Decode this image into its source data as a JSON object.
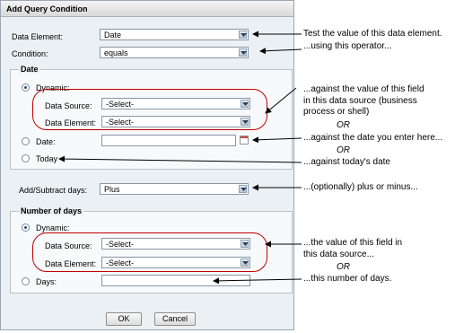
{
  "dialog": {
    "title": "Add Query Condition",
    "data_element_label": "Data Element:",
    "data_element_value": "Date",
    "condition_label": "Condition:",
    "condition_value": "equals",
    "date_group": {
      "legend": "Date",
      "dynamic_label": "Dynamic:",
      "data_source_label": "Data Source:",
      "data_source_value": "-Select-",
      "data_element_label": "Data Element:",
      "data_element_value": "-Select-",
      "date_label": "Date:",
      "date_value": "",
      "today_label": "Today"
    },
    "add_subtract_label": "Add/Subtract days:",
    "add_subtract_value": "Plus",
    "days_group": {
      "legend": "Number of days",
      "dynamic_label": "Dynamic:",
      "data_source_label": "Data Source:",
      "data_source_value": "-Select-",
      "data_element_label": "Data Element:",
      "data_element_value": "-Select-",
      "days_label": "Days:",
      "days_value": ""
    },
    "ok_label": "OK",
    "cancel_label": "Cancel"
  },
  "annotations": {
    "a1": "Test the value of this data element.",
    "a2": "...using this operator...",
    "a3_line1": "...against the value of this field",
    "a3_line2": "in this data source (business",
    "a3_line3": "process or shell)",
    "or1": "OR",
    "a4": "...against the date you enter here...",
    "or2": "OR",
    "a5": "...against today's date",
    "a6": "...(optionally) plus or minus...",
    "a7_line1": "...the value of this field in",
    "a7_line2": "this data source...",
    "or3": "OR",
    "a8": "...this number of days."
  }
}
